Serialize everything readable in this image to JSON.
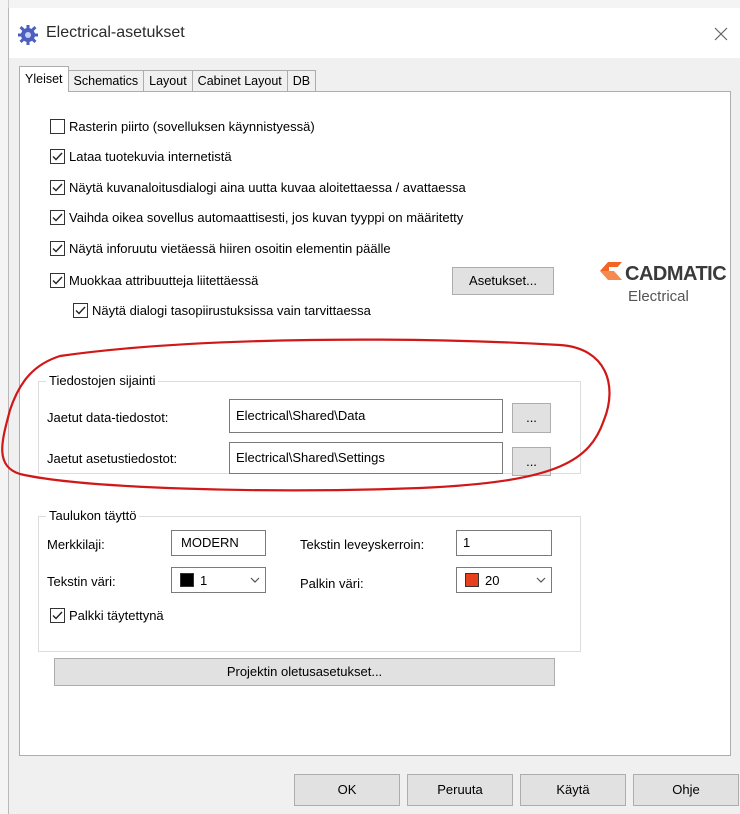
{
  "window": {
    "title": "Electrical-asetukset"
  },
  "tabs": [
    {
      "label": "Yleiset",
      "active": true
    },
    {
      "label": "Schematics",
      "active": false
    },
    {
      "label": "Layout",
      "active": false
    },
    {
      "label": "Cabinet Layout",
      "active": false
    },
    {
      "label": "DB",
      "active": false
    }
  ],
  "options": {
    "raster_label": "Rasterin piirto (sovelluksen käynnistyessä)",
    "raster_checked": false,
    "images_label": "Lataa tuotekuvia internetistä",
    "images_checked": true,
    "startdialog_label": "Näytä kuvanaloitusdialogi aina uutta kuvaa aloitettaessa / avattaessa",
    "startdialog_checked": true,
    "switchapp_label": "Vaihda oikea sovellus automaattisesti, jos kuvan tyyppi on määritetty",
    "switchapp_checked": true,
    "infowindow_label": "Näytä inforuutu vietäessä hiiren osoitin elementin päälle",
    "infowindow_checked": true,
    "editattr_label": "Muokkaa attribuutteja liitettäessä",
    "editattr_checked": true,
    "dialog_label": "Näytä dialogi tasopiirustuksissa vain tarvittaessa",
    "dialog_checked": true,
    "settings_button": "Asetukset..."
  },
  "logo": {
    "brand": "CADMATIC",
    "product": "Electrical",
    "accent_color": "#f26522"
  },
  "file_locations": {
    "title": "Tiedostojen sijainti",
    "data_label": "Jaetut data-tiedostot:",
    "data_value": "Electrical\\Shared\\Data",
    "settings_label": "Jaetut asetustiedostot:",
    "settings_value": "Electrical\\Shared\\Settings",
    "browse_label": "..."
  },
  "table_fill": {
    "title": "Taulukon täyttö",
    "font_label": "Merkkilaji:",
    "font_value": "MODERN",
    "width_label": "Tekstin leveyskerroin:",
    "width_value": "1",
    "text_color_label": "Tekstin väri:",
    "text_color_value": "1",
    "text_color_swatch": "#000000",
    "bar_color_label": "Palkin väri:",
    "bar_color_value": "20",
    "bar_color_swatch": "#e8401c",
    "filled_label": "Palkki täytettynä",
    "filled_checked": true
  },
  "project_defaults_button": "Projektin oletusasetukset...",
  "footer": {
    "ok": "OK",
    "cancel": "Peruuta",
    "apply": "Käytä",
    "help": "Ohje"
  },
  "annotation_color": "#d01818"
}
